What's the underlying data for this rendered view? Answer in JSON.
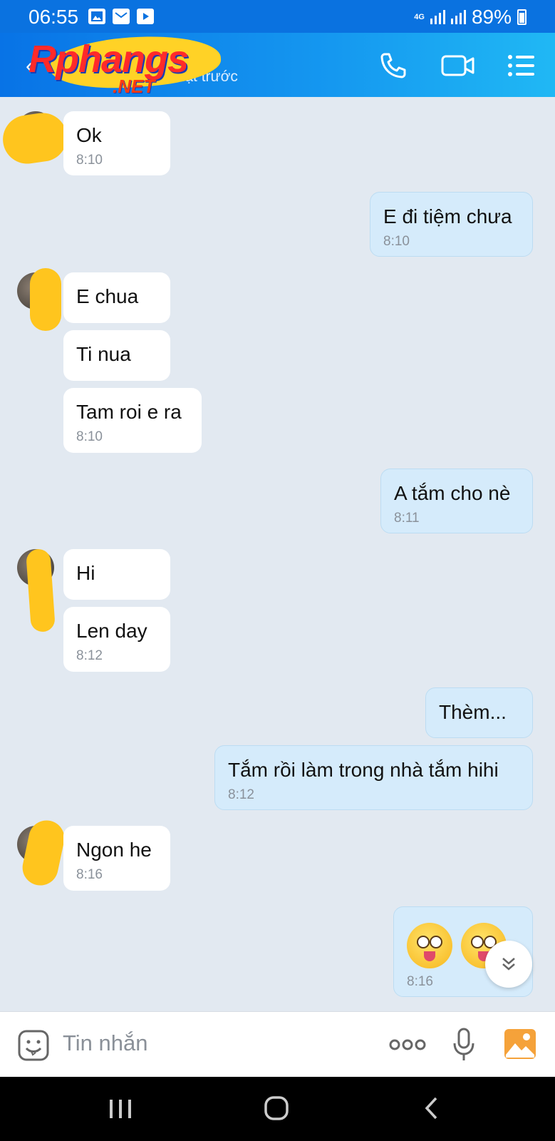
{
  "status_bar": {
    "time": "06:55",
    "network": "4G",
    "battery": "89%",
    "left_icons": [
      "gallery-icon",
      "mail-icon",
      "youtube-icon"
    ]
  },
  "header": {
    "back_icon": "back-arrow-icon",
    "contact_name": "Hà",
    "subtitle": "nhật trước",
    "watermark_logo": "Rphangs",
    "watermark_domain": ".NET",
    "actions": [
      "phone-icon",
      "video-icon",
      "menu-icon"
    ]
  },
  "messages": [
    {
      "side": "in",
      "text": "Ok",
      "time": "8:10"
    },
    {
      "side": "out",
      "text": "E đi tiệm chưa",
      "time": "8:10"
    },
    {
      "side": "in",
      "text": "E chua",
      "time": ""
    },
    {
      "side": "in",
      "text": "Ti nua",
      "time": ""
    },
    {
      "side": "in",
      "text": "Tam roi e ra",
      "time": "8:10"
    },
    {
      "side": "out",
      "text": "A tắm cho nè",
      "time": "8:11"
    },
    {
      "side": "in",
      "text": "Hi",
      "time": ""
    },
    {
      "side": "in",
      "text": "Len day",
      "time": "8:12"
    },
    {
      "side": "out",
      "text": "Thèm...",
      "time": ""
    },
    {
      "side": "out",
      "text": "Tắm rồi làm trong nhà tắm hihi",
      "time": "8:12"
    },
    {
      "side": "in",
      "text": "Ngon he",
      "time": "8:16"
    },
    {
      "side": "out",
      "text": "",
      "time": "8:16",
      "emojis": [
        "tongue-face-emoji",
        "tongue-face-emoji"
      ]
    }
  ],
  "input": {
    "placeholder": "Tin nhắn",
    "icons": [
      "sticker-icon",
      "more-icon",
      "microphone-icon",
      "image-icon"
    ]
  },
  "nav_bar": [
    "recent-apps-icon",
    "home-icon",
    "back-icon"
  ],
  "colors": {
    "header": "#0a72e0",
    "chat_bg": "#e2e9f1",
    "bubble_in": "#ffffff",
    "bubble_out": "#d5ebfb"
  }
}
